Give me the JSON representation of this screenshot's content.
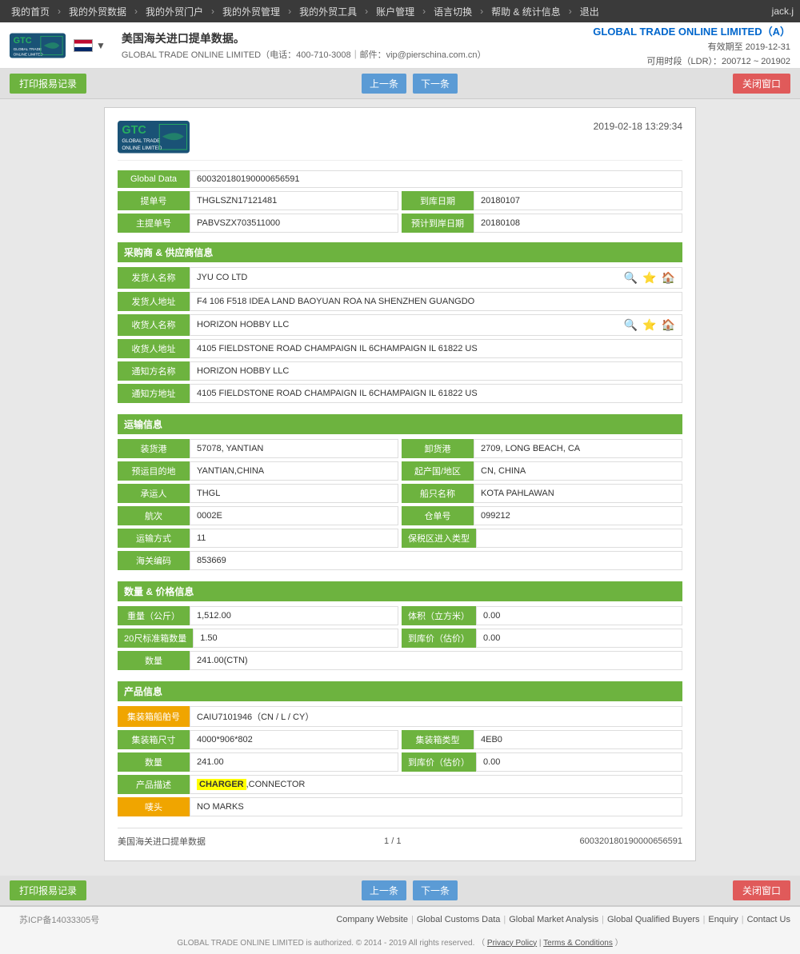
{
  "nav": {
    "items": [
      "我的首页",
      "我的外贸数据",
      "我的外贸门户",
      "我的外贸管理",
      "我的外贸工具",
      "账户管理",
      "语言切换",
      "帮助 & 统计信息",
      "退出"
    ],
    "user": "jack.j"
  },
  "header": {
    "title": "美国海关进口提单数据。",
    "subtitle": "GLOBAL TRADE ONLINE LIMITED（电话：400-710-3008｜邮件：vip@pierschina.com.cn）",
    "company": "GLOBAL TRADE ONLINE LIMITED（A）",
    "valid_until": "有效期至 2019-12-31",
    "time_range": "可用时段（LDR）：200712 ~ 201902",
    "flag_lang": "▼"
  },
  "toolbar": {
    "print_btn": "打印报易记录",
    "prev_btn": "上一条",
    "next_btn": "下一条",
    "close_btn": "关闭窗口"
  },
  "doc": {
    "datetime": "2019-02-18 13:29:34",
    "global_data_label": "Global Data",
    "global_data_value": "600320180190000656591",
    "bill_no_label": "提单号",
    "bill_no_value": "THGLSZN17121481",
    "arrival_date_label": "到库日期",
    "arrival_date_value": "20180107",
    "master_bill_label": "主提单号",
    "master_bill_value": "PABVSZX703511000",
    "estimated_date_label": "预计到岸日期",
    "estimated_date_value": "20180108",
    "section_buyer_supplier": "采购商 & 供应商信息",
    "shipper_label": "发货人名称",
    "shipper_value": "JYU CO LTD",
    "shipper_addr_label": "发货人地址",
    "shipper_addr_value": "F4 106 F518 IDEA LAND BAOYUAN ROA NA SHENZHEN GUANGDO",
    "consignee_label": "收货人名称",
    "consignee_value": "HORIZON HOBBY LLC",
    "consignee_addr_label": "收货人地址",
    "consignee_addr_value": "4105 FIELDSTONE ROAD CHAMPAIGN IL 6CHAMPAIGN IL 61822 US",
    "notify_label": "通知方名称",
    "notify_value": "HORIZON HOBBY LLC",
    "notify_addr_label": "通知方地址",
    "notify_addr_value": "4105 FIELDSTONE ROAD CHAMPAIGN IL 6CHAMPAIGN IL 61822 US",
    "section_transport": "运输信息",
    "loading_port_label": "装货港",
    "loading_port_value": "57078, YANTIAN",
    "discharge_port_label": "卸货港",
    "discharge_port_value": "2709, LONG BEACH, CA",
    "pre_dest_label": "预运目的地",
    "pre_dest_value": "YANTIAN,CHINA",
    "origin_label": "起产国/地区",
    "origin_value": "CN, CHINA",
    "carrier_label": "承运人",
    "carrier_value": "THGL",
    "vessel_label": "船只名称",
    "vessel_value": "KOTA PAHLAWAN",
    "voyage_label": "航次",
    "voyage_value": "0002E",
    "bill_of_lading_label": "仓单号",
    "bill_of_lading_value": "099212",
    "transport_method_label": "运输方式",
    "transport_method_value": "11",
    "ftz_label": "保税区进入类型",
    "ftz_value": "",
    "customs_code_label": "海关编码",
    "customs_code_value": "853669",
    "section_quantity": "数量 & 价格信息",
    "weight_label": "重量（公斤）",
    "weight_value": "1,512.00",
    "volume_label": "体积（立方米）",
    "volume_value": "0.00",
    "container20_label": "20尺标准箱数量",
    "container20_value": "1.50",
    "price_label": "到库价（估价）",
    "price_value": "0.00",
    "quantity_label": "数量",
    "quantity_value": "241.00(CTN)",
    "section_product": "产品信息",
    "container_no_label": "集装箱船舶号",
    "container_no_value": "CAIU7101946（CN / L / CY）",
    "container_size_label": "集装箱尺寸",
    "container_size_value": "4000*906*802",
    "container_type_label": "集装箱类型",
    "container_type_value": "4EB0",
    "product_qty_label": "数量",
    "product_qty_value": "241.00",
    "product_price_label": "到库价（估价）",
    "product_price_value": "0.00",
    "product_desc_label": "产品描述",
    "product_desc_highlight": "CHARGER",
    "product_desc_rest": ",CONNECTOR",
    "marks_label": "唛头",
    "marks_value": "NO MARKS",
    "footer_left": "美国海关进口提单数据",
    "footer_page": "1 / 1",
    "footer_id": "600320180190000656591"
  },
  "footer": {
    "links": [
      "Company Website",
      "Global Customs Data",
      "Global Market Analysis",
      "Global Qualified Buyers",
      "Enquiry",
      "Contact Us"
    ],
    "copyright": "GLOBAL TRADE ONLINE LIMITED is authorized. © 2014 - 2019 All rights reserved.",
    "privacy": "Privacy Policy",
    "terms": "Terms & Conditions",
    "icp": "苏ICP备14033305号"
  }
}
